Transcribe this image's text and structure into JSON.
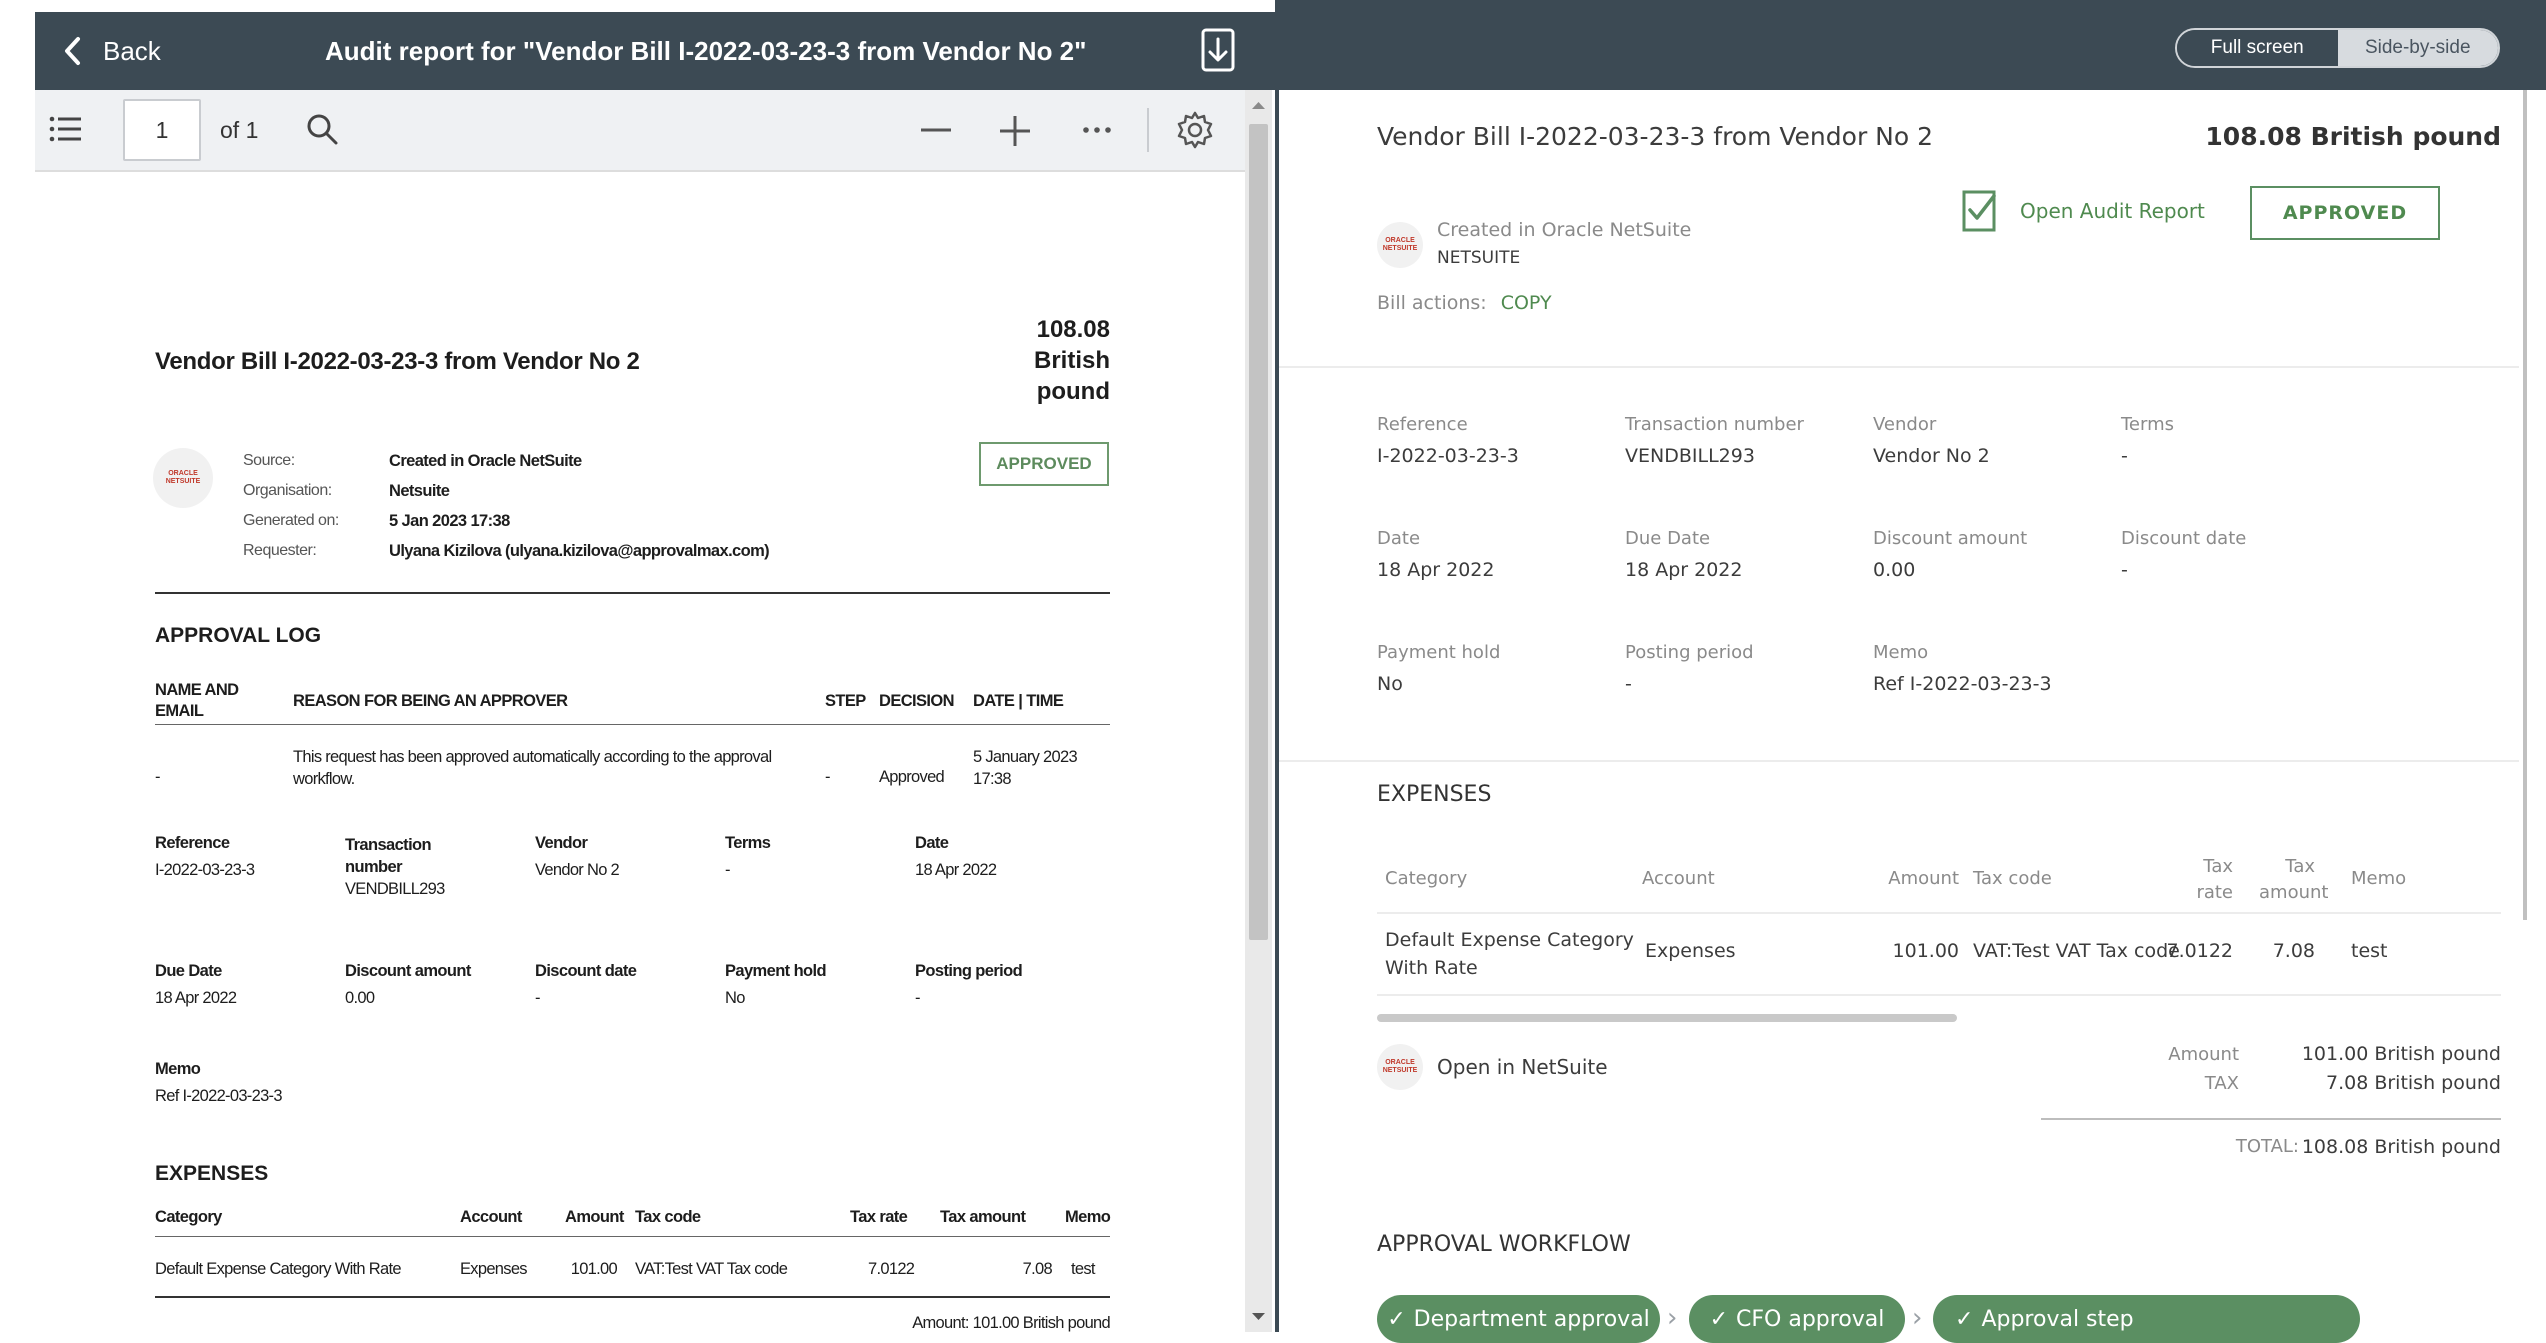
{
  "left": {
    "back_label": "Back",
    "audit_title": "Audit report for \"Vendor Bill I-2022-03-23-3 from Vendor No 2\"",
    "toolbar": {
      "page_number": "1",
      "page_of": "of 1"
    },
    "doc": {
      "title": "Vendor Bill I-2022-03-23-3 from Vendor No 2",
      "amount_line1": "108.08",
      "amount_line2": "British",
      "amount_line3": "pound",
      "status": "APPROVED",
      "logo_text": "ORACLE NETSUITE",
      "meta": [
        {
          "label": "Source:",
          "value": "Created in Oracle NetSuite"
        },
        {
          "label": "Organisation:",
          "value": "Netsuite"
        },
        {
          "label": "Generated on:",
          "value": "5 Jan 2023 17:38"
        },
        {
          "label": "Requester:",
          "value": "Ulyana Kizilova (ulyana.kizilova@approvalmax.com)"
        }
      ],
      "approval_log_heading": "APPROVAL LOG",
      "log_headers": {
        "name": "NAME AND EMAIL",
        "reason": "REASON FOR BEING AN APPROVER",
        "step": "STEP",
        "decision": "DECISION",
        "datetime": "DATE | TIME"
      },
      "log_row": {
        "name": "-",
        "reason": "This request has been approved automatically according to the approval workflow.",
        "step": "-",
        "decision": "Approved",
        "datetime": "5 January 2023 17:38"
      },
      "fields_row1": [
        {
          "label": "Reference",
          "value": "I-2022-03-23-3"
        },
        {
          "label": "Transaction number",
          "value": "VENDBILL293"
        },
        {
          "label": "Vendor",
          "value": "Vendor No 2"
        },
        {
          "label": "Terms",
          "value": "-"
        },
        {
          "label": "Date",
          "value": "18 Apr 2022"
        }
      ],
      "fields_row2": [
        {
          "label": "Due Date",
          "value": "18 Apr 2022"
        },
        {
          "label": "Discount amount",
          "value": "0.00"
        },
        {
          "label": "Discount date",
          "value": "-"
        },
        {
          "label": "Payment hold",
          "value": "No"
        },
        {
          "label": "Posting period",
          "value": "-"
        }
      ],
      "memo_label": "Memo",
      "memo_value": "Ref I-2022-03-23-3",
      "expenses_heading": "EXPENSES",
      "expense_headers": {
        "category": "Category",
        "account": "Account",
        "amount": "Amount",
        "tax_code": "Tax code",
        "tax_rate": "Tax rate",
        "tax_amount": "Tax amount",
        "memo": "Memo"
      },
      "expense_row": {
        "category": "Default Expense Category With Rate",
        "account": "Expenses",
        "amount": "101.00",
        "tax_code": "VAT:Test VAT Tax code",
        "tax_rate": "7.0122",
        "tax_amount": "7.08",
        "memo": "test"
      },
      "amount_footer": "Amount: 101.00 British pound"
    }
  },
  "right": {
    "toggle": {
      "full": "Full screen",
      "side": "Side-by-side"
    },
    "title": "Vendor Bill I-2022-03-23-3 from Vendor No 2",
    "total": "108.08 British pound",
    "open_audit_label": "Open Audit Report",
    "status": "APPROVED",
    "created_in": "Created in Oracle NetSuite",
    "org": "NETSUITE",
    "bill_actions_label": "Bill actions:",
    "bill_action_copy": "COPY",
    "fields": [
      {
        "label": "Reference",
        "value": "I-2022-03-23-3"
      },
      {
        "label": "Transaction number",
        "value": "VENDBILL293"
      },
      {
        "label": "Vendor",
        "value": "Vendor No 2"
      },
      {
        "label": "Terms",
        "value": "-"
      },
      {
        "label": "Date",
        "value": "18 Apr 2022"
      },
      {
        "label": "Due Date",
        "value": "18 Apr 2022"
      },
      {
        "label": "Discount amount",
        "value": "0.00"
      },
      {
        "label": "Discount date",
        "value": "-"
      },
      {
        "label": "Payment hold",
        "value": "No"
      },
      {
        "label": "Posting period",
        "value": "-"
      },
      {
        "label": "Memo",
        "value": "Ref I-2022-03-23-3"
      }
    ],
    "expenses_heading": "EXPENSES",
    "expense_headers": {
      "category": "Category",
      "account": "Account",
      "amount": "Amount",
      "tax_code": "Tax code",
      "tax_rate_1": "Tax",
      "tax_rate_2": "rate",
      "tax_amount_1": "Tax",
      "tax_amount_2": "amount",
      "memo": "Memo"
    },
    "expense_row": {
      "category_1": "Default Expense Category",
      "category_2": "With Rate",
      "account": "Expenses",
      "amount": "101.00",
      "tax_code": "VAT:Test VAT Tax code",
      "tax_rate": "7.0122",
      "tax_amount": "7.08",
      "memo": "test"
    },
    "open_in_netsuite": "Open in NetSuite",
    "summary": {
      "amount_label": "Amount",
      "amount_value": "101.00 British pound",
      "tax_label": "TAX",
      "tax_value": "7.08 British pound",
      "total_label": "TOTAL:",
      "total_value": "108.08 British pound"
    },
    "workflow_heading": "APPROVAL WORKFLOW",
    "workflow_steps": [
      "Department approval",
      "CFO approval",
      "Approval step"
    ],
    "colors": {
      "header": "#3c4a54",
      "accent_green": "#5b8f62"
    }
  }
}
